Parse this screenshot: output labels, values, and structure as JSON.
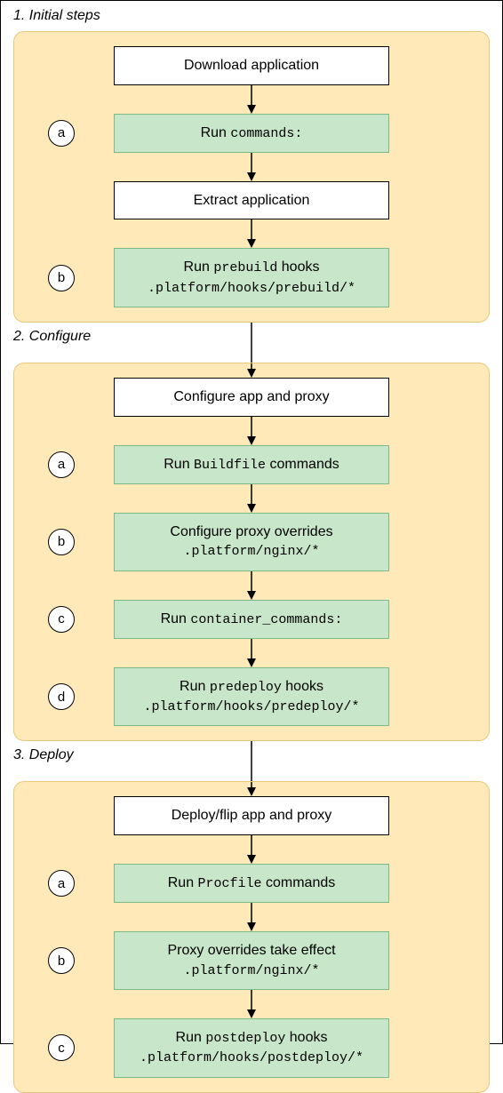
{
  "sections": [
    {
      "title": "1. Initial steps",
      "id": "initial",
      "steps": [
        {
          "badge": "",
          "type": "white",
          "line1_pre": "",
          "line1_mono": "",
          "line1_post": "Download application",
          "line2": ""
        },
        {
          "badge": "a",
          "type": "green",
          "line1_pre": "Run ",
          "line1_mono": "commands:",
          "line1_post": "",
          "line2": ""
        },
        {
          "badge": "",
          "type": "white",
          "line1_pre": "",
          "line1_mono": "",
          "line1_post": "Extract application",
          "line2": ""
        },
        {
          "badge": "b",
          "type": "green",
          "line1_pre": "Run ",
          "line1_mono": "prebuild",
          "line1_post": " hooks",
          "line2": ".platform/hooks/prebuild/*"
        }
      ]
    },
    {
      "title": "2. Configure",
      "id": "configure",
      "steps": [
        {
          "badge": "",
          "type": "white",
          "line1_pre": "",
          "line1_mono": "",
          "line1_post": "Configure app and proxy",
          "line2": ""
        },
        {
          "badge": "a",
          "type": "green",
          "line1_pre": "Run ",
          "line1_mono": "Buildfile",
          "line1_post": " commands",
          "line2": ""
        },
        {
          "badge": "b",
          "type": "green",
          "line1_pre": "",
          "line1_mono": "",
          "line1_post": "Configure proxy overrides",
          "line2": ".platform/nginx/*"
        },
        {
          "badge": "c",
          "type": "green",
          "line1_pre": "Run ",
          "line1_mono": "container_commands:",
          "line1_post": "",
          "line2": ""
        },
        {
          "badge": "d",
          "type": "green",
          "line1_pre": "Run ",
          "line1_mono": "predeploy",
          "line1_post": " hooks",
          "line2": ".platform/hooks/predeploy/*"
        }
      ]
    },
    {
      "title": "3. Deploy",
      "id": "deploy",
      "steps": [
        {
          "badge": "",
          "type": "white",
          "line1_pre": "",
          "line1_mono": "",
          "line1_post": "Deploy/flip app and proxy",
          "line2": ""
        },
        {
          "badge": "a",
          "type": "green",
          "line1_pre": "Run ",
          "line1_mono": "Procfile",
          "line1_post": " commands",
          "line2": ""
        },
        {
          "badge": "b",
          "type": "green",
          "line1_pre": "",
          "line1_mono": "",
          "line1_post": "Proxy overrides take effect",
          "line2": ".platform/nginx/*"
        },
        {
          "badge": "c",
          "type": "green",
          "line1_pre": "Run ",
          "line1_mono": "postdeploy",
          "line1_post": " hooks",
          "line2": ".platform/hooks/postdeploy/*"
        }
      ]
    }
  ]
}
